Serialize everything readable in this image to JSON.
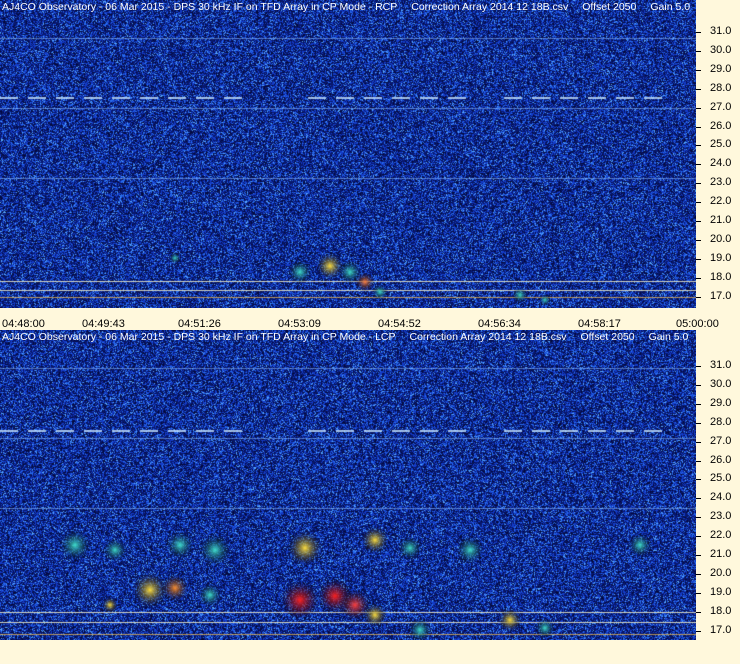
{
  "panels": [
    {
      "id": "rcp",
      "title_main": "AJ4CO Observatory - 06 Mar 2015 - DPS 30 kHz IF on TFD Array in CP Mode - RCP",
      "title_correction": "Correction Array 2014 12 18B.csv",
      "title_offset": "Offset 2050",
      "title_gain": "Gain 5.0",
      "y_ticks": [
        "31.0",
        "30.0",
        "29.0",
        "28.0",
        "27.0",
        "26.0",
        "25.0",
        "24.0",
        "23.0",
        "22.0",
        "21.0",
        "20.0",
        "19.0",
        "18.0",
        "17.0"
      ]
    },
    {
      "id": "lcp",
      "title_main": "AJ4CO Observatory - 06 Mar 2015 - DPS 30 kHz IF on TFD Array in CP Mode - LCP",
      "title_correction": "Correction Array 2014 12 18B.csv",
      "title_offset": "Offset 2050",
      "title_gain": "Gain 5.0",
      "y_ticks": [
        "31.0",
        "30.0",
        "29.0",
        "28.0",
        "27.0",
        "26.0",
        "25.0",
        "24.0",
        "23.0",
        "22.0",
        "21.0",
        "20.0",
        "19.0",
        "18.0",
        "17.0"
      ]
    }
  ],
  "x_axis": {
    "labels": [
      "04:48:00",
      "04:49:43",
      "04:51:26",
      "04:53:09",
      "04:54:52",
      "04:56:34",
      "04:58:17",
      "05:00:00"
    ]
  },
  "colors": {
    "background": "#0a1f7a",
    "noise": "#1e4fd8",
    "interference": "#7fb8ff",
    "burst_hot": "#ff2020",
    "burst_warm": "#ffe040",
    "burst_cool": "#40e0d0"
  }
}
